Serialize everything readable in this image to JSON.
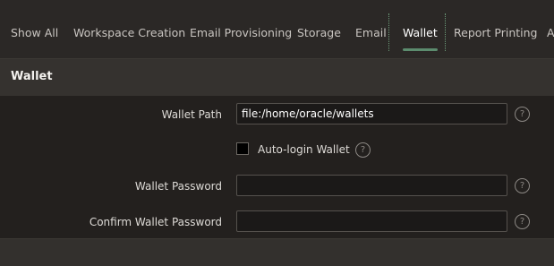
{
  "tabs": [
    {
      "label": "Show All"
    },
    {
      "label": "Workspace Creation"
    },
    {
      "label": "Email Provisioning"
    },
    {
      "label": "Storage"
    },
    {
      "label": "Email"
    },
    {
      "label": "Wallet",
      "active": true
    },
    {
      "label": "Report Printing"
    },
    {
      "label": "A"
    }
  ],
  "panel": {
    "title": "Wallet"
  },
  "form": {
    "wallet_path": {
      "label": "Wallet Path",
      "value": "file:/home/oracle/wallets"
    },
    "auto_login": {
      "label": "Auto-login Wallet",
      "checked": false
    },
    "wallet_password": {
      "label": "Wallet Password",
      "value": ""
    },
    "confirm_wallet_password": {
      "label": "Confirm Wallet Password",
      "value": ""
    }
  },
  "help_icon_glyph": "?",
  "colors": {
    "active_tab_underline": "#5c8c6e",
    "background": "#2b2826"
  }
}
